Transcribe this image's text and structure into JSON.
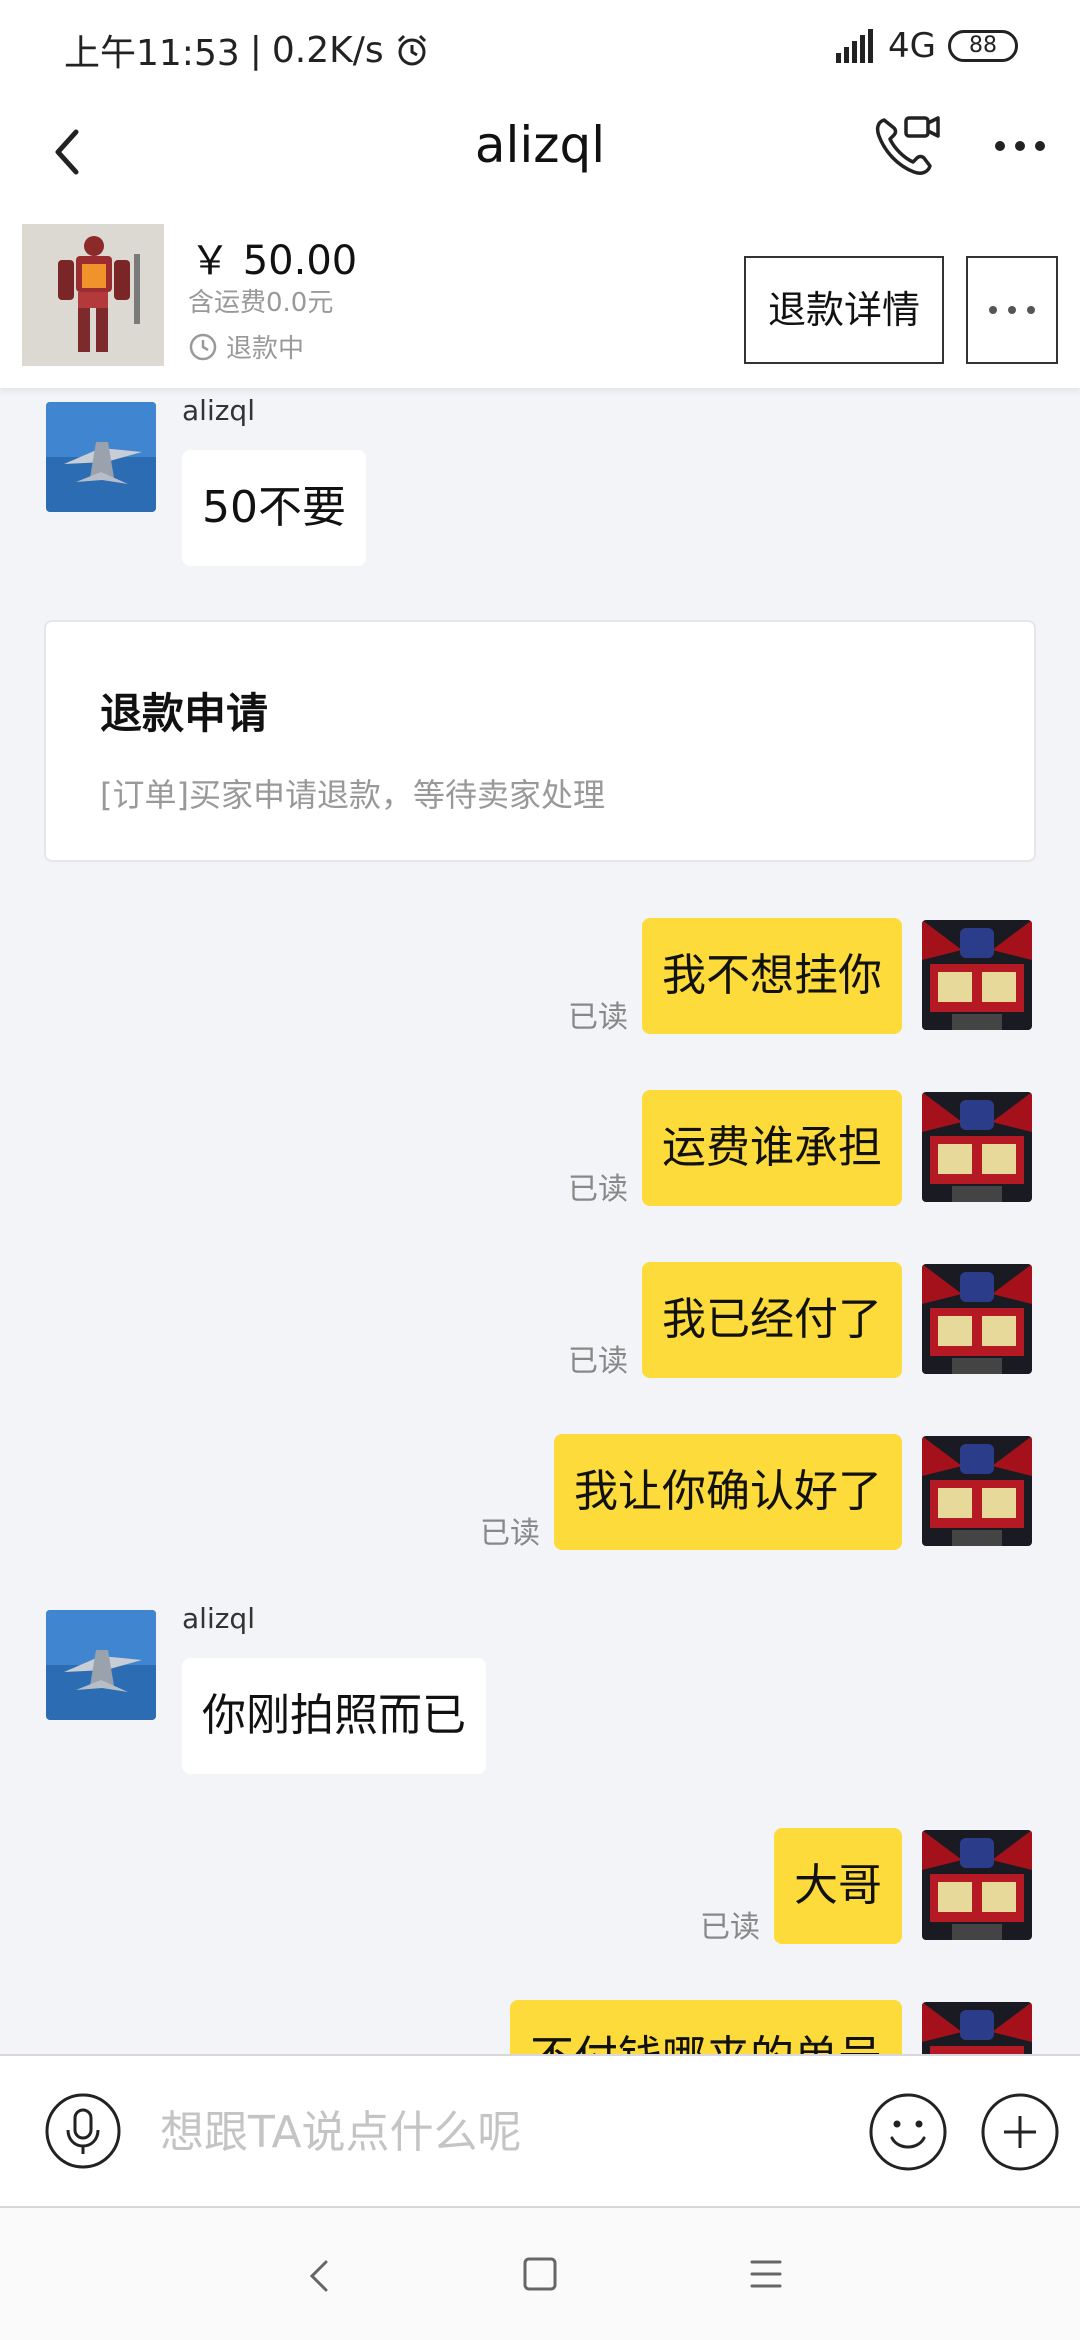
{
  "status_bar": {
    "time": "上午11:53",
    "divider": "|",
    "speed": "0.2K/s",
    "network": "4G",
    "battery": "88"
  },
  "header": {
    "title": "alizql",
    "icons": {
      "back": "chevron-left-icon",
      "call": "video-call-icon",
      "more": "more-dots-icon"
    }
  },
  "product": {
    "price": "￥ 50.00",
    "shipping": "含运费0.0元",
    "status": "退款中",
    "refund_detail_label": "退款详情"
  },
  "messages": [
    {
      "side": "in",
      "sender": "alizql",
      "text": "50不要"
    },
    {
      "side": "out",
      "text": "我不想挂你",
      "read": "已读"
    },
    {
      "side": "out",
      "text": "运费谁承担",
      "read": "已读"
    },
    {
      "side": "out",
      "text": "我已经付了",
      "read": "已读"
    },
    {
      "side": "out",
      "text": "我让你确认好了",
      "read": "已读"
    },
    {
      "side": "in",
      "sender": "alizql",
      "text": "你刚拍照而已"
    },
    {
      "side": "out",
      "text": "大哥",
      "read": "已读"
    },
    {
      "side": "out",
      "text": "不付钱哪来的单号"
    }
  ],
  "refund_card": {
    "title": "退款申请",
    "description": "[订单]买家申请退款，等待卖家处理"
  },
  "input": {
    "placeholder": "想跟TA说点什么呢"
  },
  "colors": {
    "outgoing_bubble": "#fddb3a",
    "incoming_bubble": "#ffffff",
    "chat_background": "#f3f4f8"
  }
}
